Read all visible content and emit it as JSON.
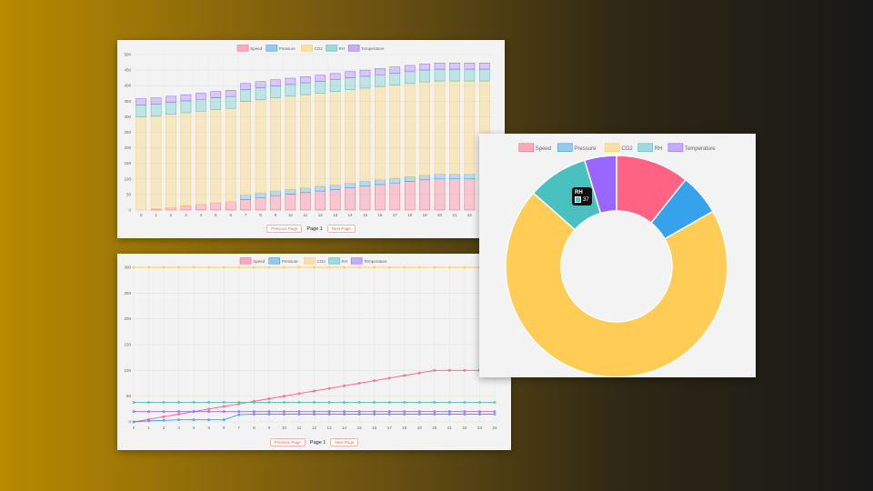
{
  "legend": [
    "Speed",
    "Pressure",
    "CO2",
    "RH",
    "Temperature"
  ],
  "colors": {
    "Speed": "#ff6384",
    "Pressure": "#36a2eb",
    "CO2": "#ffcd56",
    "RH": "#4bc0c0",
    "Temperature": "#9966ff"
  },
  "pager": {
    "prev_label": "Previous Page",
    "page_label": "Page 1",
    "next_label": "Next Page"
  },
  "chart_data": [
    {
      "type": "bar",
      "stacked": true,
      "categories": [
        "0",
        "1",
        "2",
        "3",
        "4",
        "5",
        "6",
        "7",
        "8",
        "9",
        "10",
        "11",
        "12",
        "13",
        "14",
        "15",
        "16",
        "17",
        "18",
        "19",
        "20",
        "21",
        "22",
        "23"
      ],
      "series": [
        {
          "name": "Speed",
          "values": [
            0,
            3,
            8,
            13,
            18,
            23,
            27,
            34,
            40,
            46,
            51,
            56,
            61,
            66,
            72,
            77,
            82,
            87,
            92,
            97,
            100,
            100,
            100,
            100
          ]
        },
        {
          "name": "Pressure",
          "values": [
            0,
            0,
            0,
            0,
            0,
            0,
            0,
            15,
            15,
            15,
            15,
            15,
            15,
            15,
            15,
            15,
            15,
            15,
            15,
            15,
            15,
            15,
            15,
            15
          ]
        },
        {
          "name": "CO2",
          "values": [
            300,
            300,
            300,
            300,
            300,
            300,
            300,
            300,
            300,
            300,
            300,
            300,
            300,
            300,
            300,
            300,
            300,
            300,
            300,
            300,
            300,
            300,
            300,
            300
          ]
        },
        {
          "name": "RH",
          "values": [
            38,
            38,
            38,
            38,
            38,
            38,
            38,
            38,
            38,
            38,
            38,
            38,
            38,
            38,
            38,
            38,
            38,
            38,
            38,
            38,
            38,
            38,
            38,
            38
          ]
        },
        {
          "name": "Temperature",
          "values": [
            20,
            20,
            20,
            20,
            20,
            20,
            20,
            20,
            20,
            20,
            20,
            20,
            20,
            20,
            20,
            20,
            20,
            20,
            20,
            20,
            20,
            20,
            20,
            20
          ]
        }
      ],
      "ylim": [
        0,
        500
      ],
      "yticks": [
        0,
        50,
        100,
        150,
        200,
        250,
        300,
        350,
        400,
        450,
        500
      ],
      "legend_position": "top"
    },
    {
      "type": "line",
      "x": [
        "0",
        "1",
        "2",
        "3",
        "4",
        "5",
        "6",
        "7",
        "8",
        "9",
        "10",
        "11",
        "12",
        "13",
        "14",
        "15",
        "16",
        "17",
        "18",
        "19",
        "20",
        "21",
        "22",
        "23",
        "24"
      ],
      "series": [
        {
          "name": "Speed",
          "values": [
            0,
            5,
            10,
            15,
            20,
            25,
            30,
            35,
            40,
            45,
            50,
            55,
            60,
            65,
            70,
            75,
            80,
            85,
            90,
            95,
            100,
            100,
            100,
            100,
            100
          ]
        },
        {
          "name": "Pressure",
          "values": [
            0,
            2,
            3,
            4,
            4,
            4,
            4,
            14,
            15,
            15,
            15,
            15,
            15,
            15,
            15,
            15,
            15,
            15,
            15,
            15,
            15,
            15,
            15,
            15,
            15
          ]
        },
        {
          "name": "CO2",
          "values": [
            300,
            300,
            300,
            300,
            300,
            300,
            300,
            300,
            300,
            300,
            300,
            300,
            300,
            300,
            300,
            300,
            300,
            300,
            300,
            300,
            300,
            300,
            300,
            300,
            300
          ]
        },
        {
          "name": "RH",
          "values": [
            38,
            38,
            38,
            38,
            38,
            38,
            38,
            38,
            38,
            38,
            38,
            38,
            38,
            38,
            38,
            38,
            38,
            38,
            38,
            38,
            38,
            38,
            38,
            38,
            38
          ]
        },
        {
          "name": "Temperature",
          "values": [
            20,
            20,
            20,
            20,
            20,
            20,
            20,
            20,
            20,
            20,
            20,
            20,
            20,
            20,
            20,
            20,
            20,
            20,
            20,
            20,
            20,
            20,
            20,
            20,
            20
          ]
        }
      ],
      "ylim": [
        0,
        300
      ],
      "yticks": [
        0,
        50,
        100,
        150,
        200,
        250,
        300
      ],
      "legend_position": "top"
    },
    {
      "type": "pie",
      "variant": "doughnut",
      "labels": [
        "Speed",
        "Pressure",
        "CO2",
        "RH",
        "Temperature"
      ],
      "values": [
        46,
        26,
        300,
        38,
        20
      ],
      "legend_position": "top",
      "tooltip": {
        "label": "RH",
        "value": "37"
      }
    }
  ]
}
